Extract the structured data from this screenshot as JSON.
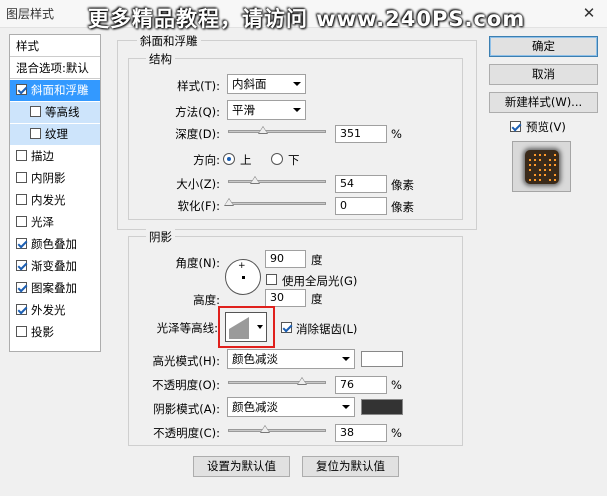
{
  "window": {
    "title": "图层样式",
    "watermark": "更多精品教程，请访问 www.240PS.com",
    "close_glyph": "✕"
  },
  "sidebar": {
    "items": [
      {
        "label": "样式",
        "checkbox": null
      },
      {
        "label": "混合选项:默认",
        "checkbox": null
      },
      {
        "label": "斜面和浮雕",
        "checkbox": true,
        "selected": true
      },
      {
        "label": "等高线",
        "checkbox": false,
        "sub": true
      },
      {
        "label": "纹理",
        "checkbox": false,
        "sub": true
      },
      {
        "label": "描边",
        "checkbox": false
      },
      {
        "label": "内阴影",
        "checkbox": false
      },
      {
        "label": "内发光",
        "checkbox": false
      },
      {
        "label": "光泽",
        "checkbox": false
      },
      {
        "label": "颜色叠加",
        "checkbox": true
      },
      {
        "label": "渐变叠加",
        "checkbox": true
      },
      {
        "label": "图案叠加",
        "checkbox": true
      },
      {
        "label": "外发光",
        "checkbox": true
      },
      {
        "label": "投影",
        "checkbox": false
      }
    ]
  },
  "bevel": {
    "group_title": "斜面和浮雕",
    "structure_title": "结构",
    "style_label": "样式(T):",
    "style_value": "内斜面",
    "technique_label": "方法(Q):",
    "technique_value": "平滑",
    "depth_label": "深度(D):",
    "depth_value": "351",
    "depth_pct": 0.35,
    "depth_unit": "%",
    "direction_label": "方向:",
    "direction_up": "上",
    "direction_down": "下",
    "size_label": "大小(Z):",
    "size_value": "54",
    "size_pct": 0.27,
    "size_unit": "像素",
    "soften_label": "软化(F):",
    "soften_value": "0",
    "soften_pct": 0.0,
    "soften_unit": "像素"
  },
  "shading": {
    "title": "阴影",
    "angle_label": "角度(N):",
    "angle_value": "90",
    "angle_unit": "度",
    "global_light_label": "使用全局光(G)",
    "altitude_label": "高度:",
    "altitude_value": "30",
    "altitude_unit": "度",
    "gloss_contour_label": "光泽等高线:",
    "anti_alias_label": "消除锯齿(L)",
    "highlight_mode_label": "高光模式(H):",
    "highlight_mode_value": "颜色减淡",
    "highlight_color": "#ffffff",
    "highlight_opacity_label": "不透明度(O):",
    "highlight_opacity_value": "76",
    "highlight_opacity_pct": 0.76,
    "shadow_mode_label": "阴影模式(A):",
    "shadow_mode_value": "颜色减淡",
    "shadow_color": "#333333",
    "shadow_opacity_label": "不透明度(C):",
    "shadow_opacity_value": "38",
    "shadow_opacity_pct": 0.38,
    "pct_unit": "%"
  },
  "buttons": {
    "make_default": "设置为默认值",
    "reset_default": "复位为默认值",
    "ok": "确定",
    "cancel": "取消",
    "new_style": "新建样式(W)...",
    "preview_label": "预览(V)"
  },
  "colors": {
    "highlight_red": "#e0201c",
    "selection_blue": "#3399ff"
  }
}
